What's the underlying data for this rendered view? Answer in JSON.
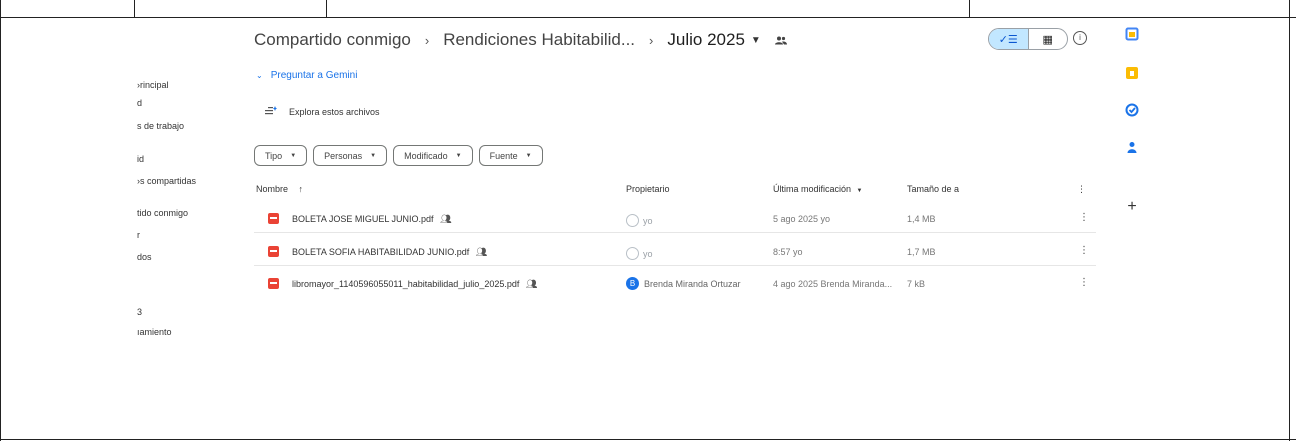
{
  "sidebar": {
    "items": [
      {
        "label": "›rincipal"
      },
      {
        "label": "d"
      },
      {
        "label": "s de trabajo"
      },
      {
        "label": "id"
      },
      {
        "label": "›s compartidas"
      },
      {
        "label": "tido conmigo"
      },
      {
        "label": "r"
      },
      {
        "label": "dos"
      },
      {
        "label": "3"
      },
      {
        "label": "ıamiento"
      }
    ]
  },
  "breadcrumb": {
    "root": "Compartido conmigo",
    "middle": "Rendiciones Habitabilid...",
    "current": "Julio 2025"
  },
  "toolbar": {
    "list_view_label": "✓☰",
    "grid_view_label": "▦",
    "info_label": "i"
  },
  "gemini": {
    "label": "Preguntar a Gemini"
  },
  "explore": {
    "label": "Explora estos archivos"
  },
  "chips": [
    {
      "label": "Tipo"
    },
    {
      "label": "Personas"
    },
    {
      "label": "Modificado"
    },
    {
      "label": "Fuente"
    }
  ],
  "columns": {
    "name": "Nombre",
    "owner": "Propietario",
    "modified": "Última modificación",
    "size": "Tamaño de a"
  },
  "files": [
    {
      "name": "BOLETA JOSE MIGUEL JUNIO.pdf",
      "owner": "yo",
      "modified": "5 ago 2025 yo",
      "size": "1,4 MB"
    },
    {
      "name": "BOLETA SOFIA HABITABILIDAD JUNIO.pdf",
      "owner": "yo",
      "modified": "8:57 yo",
      "size": "1,7 MB"
    },
    {
      "name": "libromayor_1140596055011_habitabilidad_julio_2025.pdf",
      "owner": "Brenda Miranda Ortuzar",
      "owner_initial": "B",
      "modified": "4 ago 2025 Brenda Miranda...",
      "size": "7 kB"
    }
  ],
  "rail": {
    "add_label": "+"
  },
  "colors": {
    "accent": "#1a73e8",
    "pdf": "#ea4335",
    "toggle_on": "#c2e7ff"
  }
}
